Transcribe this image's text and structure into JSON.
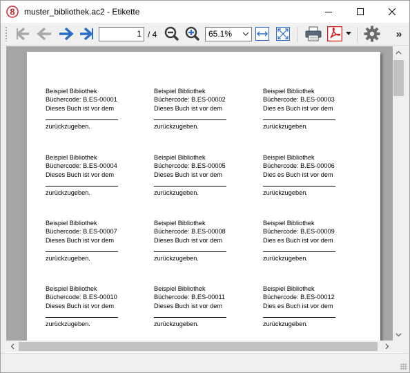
{
  "window": {
    "title": "muster_bibliothek.ac2 - Etikette",
    "app_icon": "app-8-icon",
    "controls": [
      "minimize-icon",
      "maximize-icon",
      "close-icon"
    ]
  },
  "toolbar": {
    "nav_icons": [
      "first-page-icon",
      "previous-page-icon",
      "next-page-icon",
      "last-page-icon"
    ],
    "page_value": "1",
    "page_total": "/ 4",
    "zoom_out_icon": "zoom-out-icon",
    "zoom_in_icon": "zoom-in-icon",
    "zoom_value": "65.1%",
    "zoom_dropdown_icon": "chevron-down-icon",
    "fit_width_icon": "fit-width-icon",
    "fit_page_icon": "fit-page-icon",
    "print_icon": "printer-icon",
    "pdf_icon": "pdf-icon",
    "pdf_dropdown_icon": "chevron-down-icon",
    "settings_icon": "gear-icon",
    "overflow_label": "»"
  },
  "labels": [
    {
      "line1": "Beispiel Bibliothek",
      "line2": "Büchercode: B.ES-00001",
      "line3": "Dieses Buch ist vor dem",
      "line4": "zurückzugeben."
    },
    {
      "line1": "Beispiel Bibliothek",
      "line2": "Büchercode: B.ES-00002",
      "line3": "Dieses Buch ist vor dem",
      "line4": "zurückzugeben."
    },
    {
      "line1": "Beispiel Bibliothek",
      "line2": "Büchercode: B.ES-00003",
      "line3": "Dies es Buch ist vor dem",
      "line4": "zurückzugeben."
    },
    {
      "line1": "Beispiel Bibliothek",
      "line2": "Büchercode: B.ES-00004",
      "line3": "Dieses Buch ist vor dem",
      "line4": "zurückzugeben."
    },
    {
      "line1": "Beispiel Bibliothek",
      "line2": "Büchercode: B.ES-00005",
      "line3": "Dieses Buch ist vor dem",
      "line4": "zurückzugeben."
    },
    {
      "line1": "Beispiel Bibliothek",
      "line2": "Büchercode: B.ES-00006",
      "line3": "Dies es Buch ist vor dem",
      "line4": "zurückzugeben."
    },
    {
      "line1": "Beispiel Bibliothek",
      "line2": "Büchercode: B.ES-00007",
      "line3": "Dieses Buch ist vor dem",
      "line4": "zurückzugeben."
    },
    {
      "line1": "Beispiel Bibliothek",
      "line2": "Büchercode: B.ES-00008",
      "line3": "Dieses Buch ist vor dem",
      "line4": "zurückzugeben."
    },
    {
      "line1": "Beispiel Bibliothek",
      "line2": "Büchercode: B.ES-00009",
      "line3": "Dies es Buch ist vor dem",
      "line4": "zurückzugeben."
    },
    {
      "line1": "Beispiel Bibliothek",
      "line2": "Büchercode: B.ES-00010",
      "line3": "Dieses Buch ist vor dem",
      "line4": "zurückzugeben."
    },
    {
      "line1": "Beispiel Bibliothek",
      "line2": "Büchercode: B.ES-00011",
      "line3": "Dieses Buch ist vor dem",
      "line4": "zurückzugeben."
    },
    {
      "line1": "Beispiel Bibliothek",
      "line2": "Büchercode: B.ES-00012",
      "line3": "Dies es Buch ist vor dem",
      "line4": "zurückzugeben."
    }
  ],
  "scrollbars": {
    "up_icon": "chevron-up-icon",
    "down_icon": "chevron-down-icon",
    "left_icon": "chevron-left-icon",
    "right_icon": "chevron-right-icon"
  },
  "colors": {
    "accent_blue": "#2b6cc4",
    "disabled_gray": "#a8a8a8",
    "pdf_red": "#d2191b",
    "viewport_gray": "#a5a5a5"
  }
}
